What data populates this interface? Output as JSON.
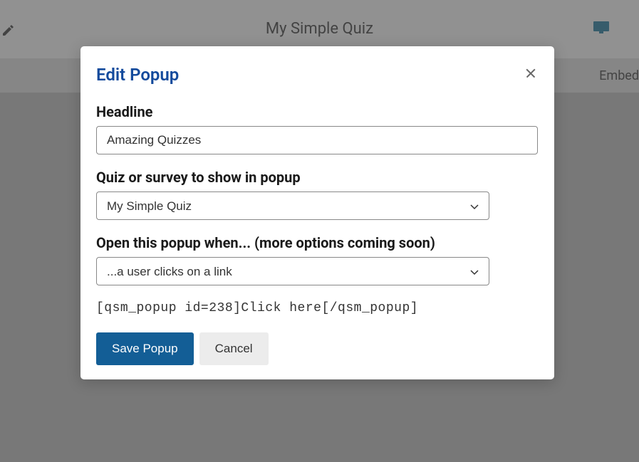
{
  "background": {
    "quiz_title": "My Simple Quiz",
    "embed_label": "Embed"
  },
  "modal": {
    "title": "Edit Popup",
    "headline": {
      "label": "Headline",
      "value": "Amazing Quizzes"
    },
    "quiz_select": {
      "label": "Quiz or survey to show in popup",
      "value": "My Simple Quiz"
    },
    "trigger_select": {
      "label": "Open this popup when... (more options coming soon)",
      "value": "...a user clicks on a link"
    },
    "shortcode": "[qsm_popup id=238]Click here[/qsm_popup]",
    "save_label": "Save Popup",
    "cancel_label": "Cancel"
  }
}
